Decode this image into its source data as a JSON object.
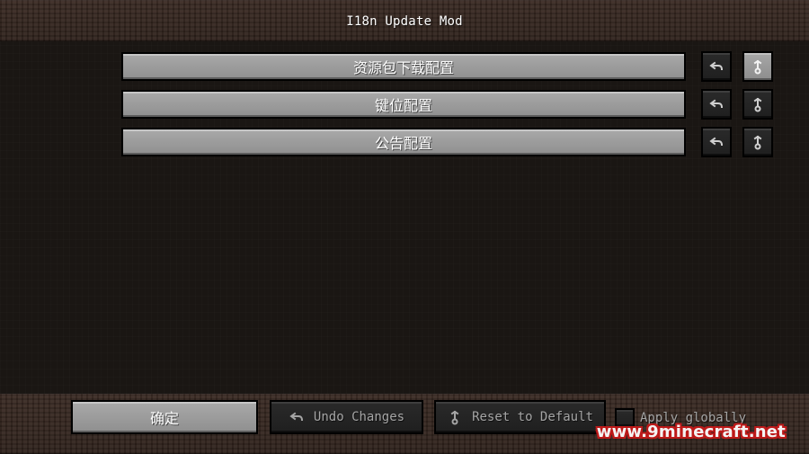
{
  "window": {
    "title": "I18n Update Mod"
  },
  "rows": [
    {
      "label": "资源包下载配置",
      "undo_icon": "undo-icon",
      "reset_icon": "reset-icon",
      "reset_style": "light"
    },
    {
      "label": "键位配置",
      "undo_icon": "undo-icon",
      "reset_icon": "reset-icon",
      "reset_style": "dark"
    },
    {
      "label": "公告配置",
      "undo_icon": "undo-icon",
      "reset_icon": "reset-icon",
      "reset_style": "dark"
    }
  ],
  "footer": {
    "confirm_label": "确定",
    "undo_changes_label": "Undo Changes",
    "reset_to_default_label": "Reset to Default",
    "apply_globally_label": "Apply globally"
  },
  "watermark": "www.9minecraft.net",
  "colors": {
    "button_light": "#9c9c9c",
    "button_dark": "#242424",
    "text_white": "#ffffff",
    "text_disabled": "#a5a5a5",
    "watermark_outline": "#c41919"
  }
}
